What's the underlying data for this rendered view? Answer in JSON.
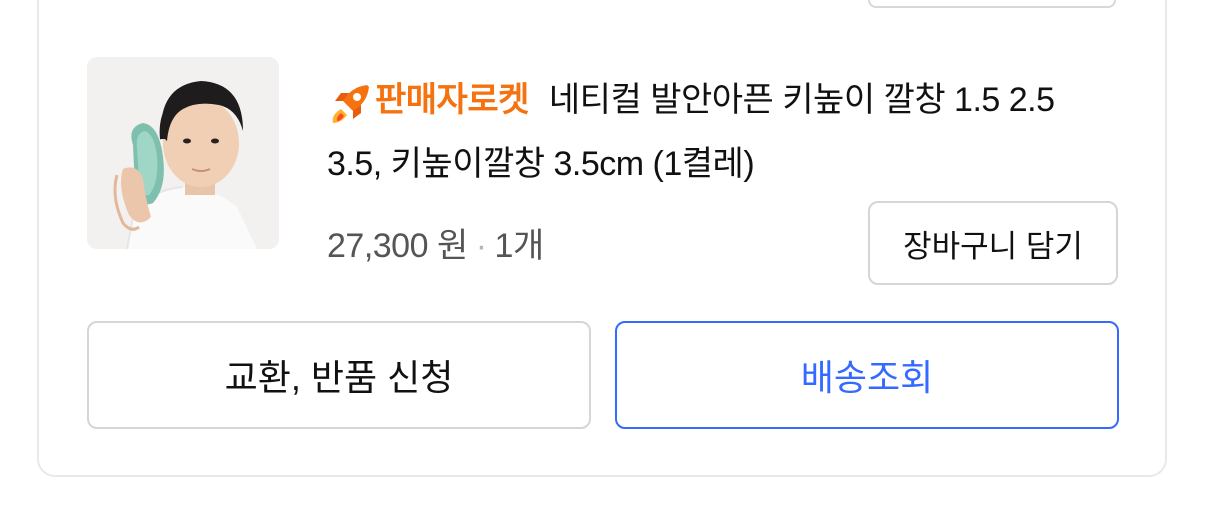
{
  "product": {
    "badge_label": "판매자로켓",
    "badge_icon": "rocket-icon",
    "badge_color": "#f5720f",
    "title": "네티컬 발안아픈 키높이 깔창 1.5 2.5 3.5, 키높이깔창 3.5cm (1켤레)",
    "price": "27,300 원",
    "separator": "·",
    "quantity": "1개",
    "image_icon": "product-photo"
  },
  "actions": {
    "add_to_cart": "장바구니 담기",
    "exchange_return": "교환, 반품 신청",
    "track_delivery": "배송조회",
    "accent_color": "#346aff"
  }
}
